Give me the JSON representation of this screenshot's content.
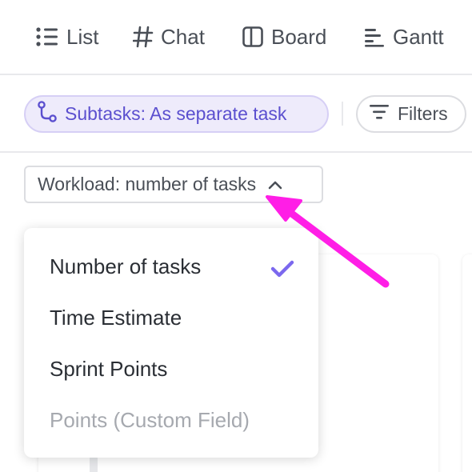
{
  "tabs": [
    {
      "label": "List",
      "icon": "list-icon"
    },
    {
      "label": "Chat",
      "icon": "hash-icon"
    },
    {
      "label": "Board",
      "icon": "board-icon"
    },
    {
      "label": "Gantt",
      "icon": "gantt-icon"
    }
  ],
  "toolbar": {
    "subtasks_label": "Subtasks: As separate task",
    "subtasks_icon": "subtasks-icon",
    "filters_label": "Filters",
    "filters_icon": "filter-icon"
  },
  "workload": {
    "label": "Workload: number of tasks",
    "icon": "chevron-up-icon"
  },
  "workload_menu": {
    "items": [
      {
        "label": "Number of tasks",
        "selected": true,
        "enabled": true
      },
      {
        "label": "Time Estimate",
        "selected": false,
        "enabled": true
      },
      {
        "label": "Sprint Points",
        "selected": false,
        "enabled": true
      },
      {
        "label": "Points (Custom Field)",
        "selected": false,
        "enabled": false
      }
    ],
    "check_icon": "check-icon"
  },
  "colors": {
    "accent": "#7b68ee",
    "chip_text": "#5b4fcf",
    "annotation_arrow": "#ff1ee6"
  }
}
